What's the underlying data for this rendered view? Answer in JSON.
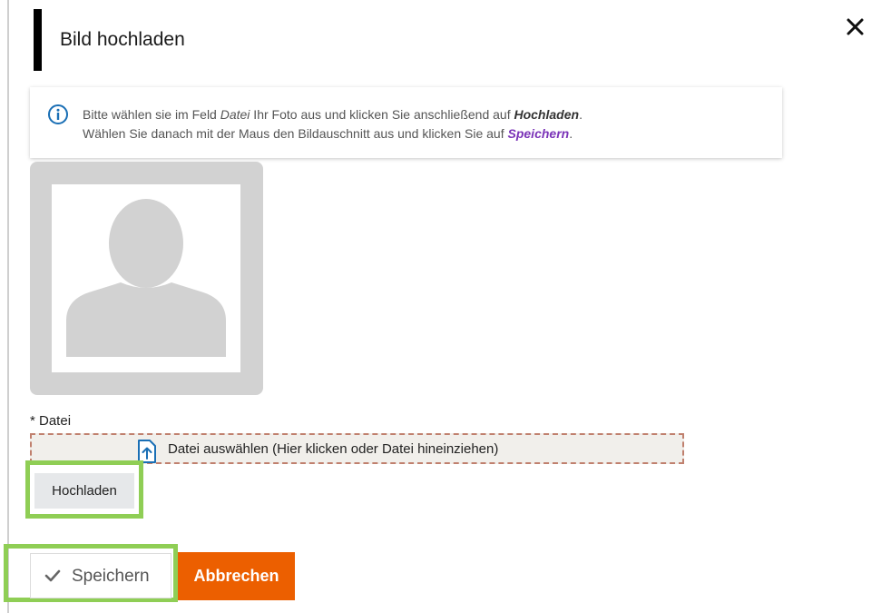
{
  "dialog": {
    "title": "Bild hochladen",
    "close_icon": "close-icon"
  },
  "info": {
    "icon": "info-circle-icon",
    "line1_a": "Bitte wählen sie im Feld ",
    "line1_field": "Datei",
    "line1_b": " Ihr Foto aus und klicken Sie anschließend auf ",
    "line1_action": "Hochladen",
    "line1_end": ".",
    "line2_a": "Wählen Sie danach mit der Maus den Bildauschnitt aus und klicken Sie auf ",
    "line2_action": "Speichern",
    "line2_end": "."
  },
  "avatar": {
    "icon": "person-placeholder-icon"
  },
  "file": {
    "label": "* Datei",
    "dropzone_text": "Datei auswählen (Hier klicken oder Datei hineinziehen)",
    "dropzone_icon": "file-upload-icon"
  },
  "buttons": {
    "upload": "Hochladen",
    "save": "Speichern",
    "save_icon": "checkmark-icon",
    "cancel": "Abbrechen"
  },
  "colors": {
    "highlight": "#8fce55",
    "cancel_bg": "#ec5f00",
    "info_icon": "#1a6fb5",
    "accent_purple": "#7b34b8",
    "dropzone_border": "#c0806e"
  }
}
